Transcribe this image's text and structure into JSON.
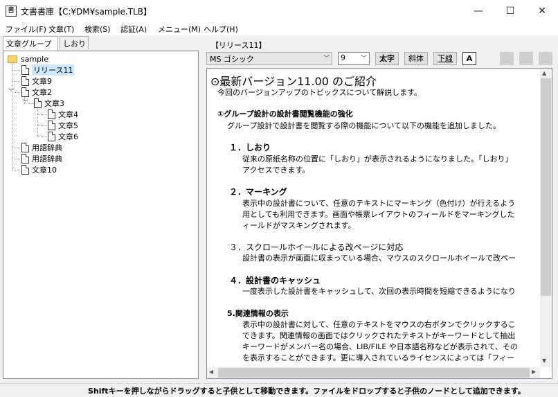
{
  "window": {
    "title": "文書書庫【C:¥DM¥sample.TLB】",
    "app_icon": "書",
    "minimize": "—",
    "maximize": "☐",
    "close": "✕"
  },
  "menu": [
    {
      "label": "ファイル(F)"
    },
    {
      "label": "文章(T)"
    },
    {
      "label": "検索(S)"
    },
    {
      "label": "認証(A)"
    },
    {
      "label": "メニュー(M)"
    },
    {
      "label": "ヘルプ(H)"
    }
  ],
  "left_tabs": [
    "文章グループ",
    "しおり"
  ],
  "tree": {
    "root": "sample",
    "items": [
      "リリース11",
      "文章9",
      "文章2",
      "文章3",
      "文章4",
      "文章5",
      "文章6",
      "用語辞典",
      "用語辞典",
      "文章10"
    ]
  },
  "doc_tab": "【リリース11】",
  "toolbar": {
    "font": "MS ゴシック",
    "size": "9",
    "bold": "太字",
    "italic": "斜体",
    "underline": "下線",
    "color": "A"
  },
  "content": {
    "heading": "最新バージョン11.00 のご紹介",
    "intro": "今回のバージョンアップのトピックスについて解説します。",
    "section1_title": "グループ設計の設計書閲覧機能の強化",
    "section1_body": "グループ設計で設計書を閲覧する際の機能について以下の機能を追加しました。",
    "item1_title": "１．しおり",
    "item1_l1": "従来の原紙名称の位置に「しおり」が表示されるようになりました。「しおり」",
    "item1_l2": "アクセスできます。",
    "item2_title": "２．マーキング",
    "item2_l1": "表示中の設計書について、任意のテキストにマーキング（色付け）が行えるよう",
    "item2_l2": "用としても利用できます。画面や帳票レイアウトのフィールドをマーキングした",
    "item2_l3": "ィールドがマスキングされます。",
    "item3_title": "３．スクロールホイールによる改ページに対応",
    "item3_l1": "設計書の表示が画面に収まっている場合、マウスのスクロールホイールで改ペー",
    "item4_title": "４．設計書のキャッシュ",
    "item4_l1": "一度表示した設計書をキャッシュして、次回の表示時間を短縮できるようになり",
    "item5_title": "5.関連情報の表示",
    "item5_l1": "表示中の設計書に対して、任意のテキストをマウスの右ボタンでクリックするこ",
    "item5_l2": "できます。関連情報の画面ではクリックされたテキストがキーワードとして抽出",
    "item5_l3": "キーワードがメンバー名の場合、LIB/FILE や日本語名称などが表示されて、その",
    "item5_l4": "を表示することができます。更に導入されているライセンスによっては「フィー"
  },
  "status": "Shiftキーを押しながらドラッグすると子供として移動できます。ファイルをドロップすると子供のノードとして追加できます。"
}
